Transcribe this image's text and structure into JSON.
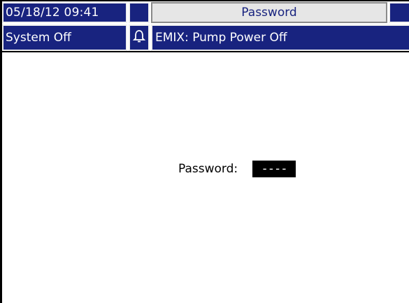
{
  "header": {
    "datetime": "05/18/12 09:41",
    "title": "Password"
  },
  "status_bar": {
    "system_status": "System Off",
    "alarm_icon": "bell-icon",
    "message": "EMIX: Pump Power Off"
  },
  "password_screen": {
    "label": "Password:",
    "field_value": "----"
  },
  "colors": {
    "bar_blue": "#18237f",
    "title_bg": "#e6e6e6",
    "field_bg": "#000000"
  }
}
